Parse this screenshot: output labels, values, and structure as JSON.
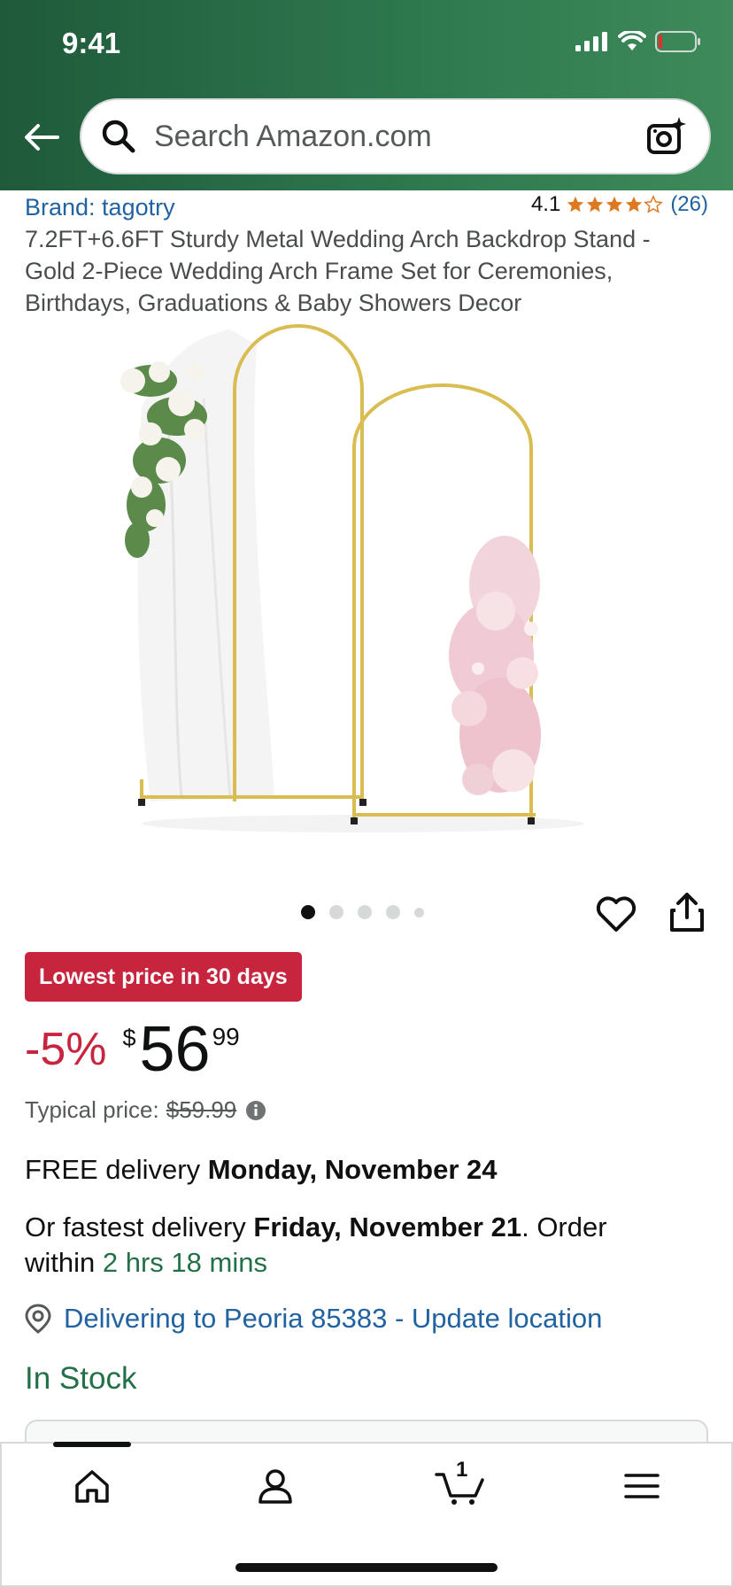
{
  "status_bar": {
    "time": "9:41"
  },
  "search": {
    "placeholder": "Search Amazon.com"
  },
  "product": {
    "brand": "Brand: tagotry",
    "rating": "4.1",
    "rating_stars": 4.1,
    "rating_count": "(26)",
    "title": "7.2FT+6.6FT Sturdy Metal Wedding Arch Backdrop Stand - Gold 2-Piece Wedding Arch Frame Set for Ceremonies, Birthdays, Graduations & Baby Showers Decor",
    "image_count": 5,
    "active_image": 1
  },
  "deal": {
    "badge": "Lowest price in 30 days"
  },
  "price": {
    "discount": "-5%",
    "currency": "$",
    "whole": "56",
    "fraction": "99",
    "typical_label": "Typical price:",
    "typical_value": "$59.99"
  },
  "delivery": {
    "free_prefix": "FREE delivery ",
    "free_date": "Monday, November 24",
    "fastest_prefix": "Or fastest delivery ",
    "fastest_date": "Friday, November 21",
    "order_within": ". Order within ",
    "countdown": "2 hrs 18 mins",
    "location": "Delivering to Peoria 85383 - Update location"
  },
  "stock": "In Stock",
  "bottom_nav": {
    "cart_count": "1"
  },
  "colors": {
    "header": "#2f7a4f",
    "link": "#2162a1",
    "deal": "#c7253e",
    "stock": "#237048",
    "star": "#de7921"
  }
}
